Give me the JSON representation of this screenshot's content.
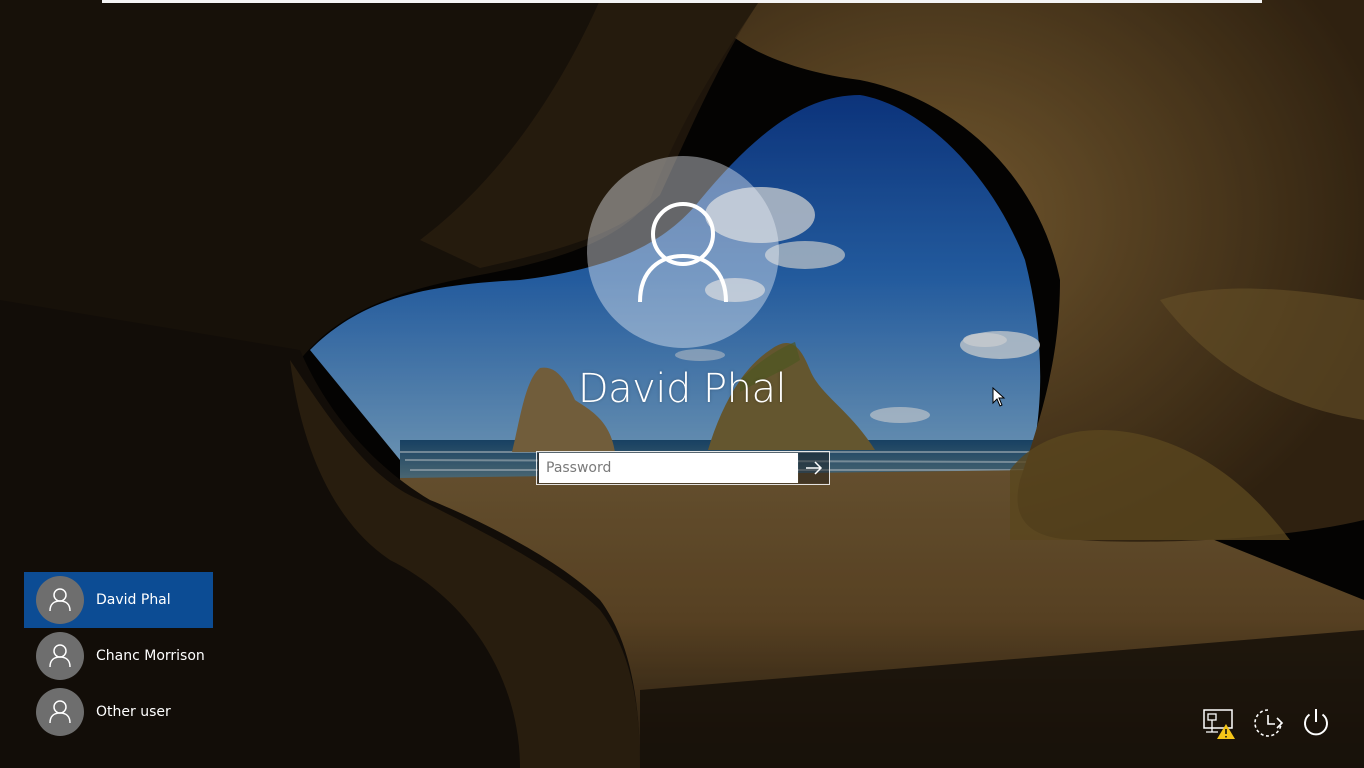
{
  "login": {
    "username": "David Phal",
    "password_placeholder": "Password"
  },
  "user_list": [
    {
      "name": "David Phal",
      "selected": true
    },
    {
      "name": "Chanc Morrison",
      "selected": false
    },
    {
      "name": "Other user",
      "selected": false
    }
  ],
  "system_icons": [
    "network-warning-icon",
    "ease-of-access-icon",
    "power-icon"
  ],
  "colors": {
    "selected_tile": "#0c4c94",
    "tile_avatar": "#6e6e6e",
    "warning": "#f5c518"
  }
}
